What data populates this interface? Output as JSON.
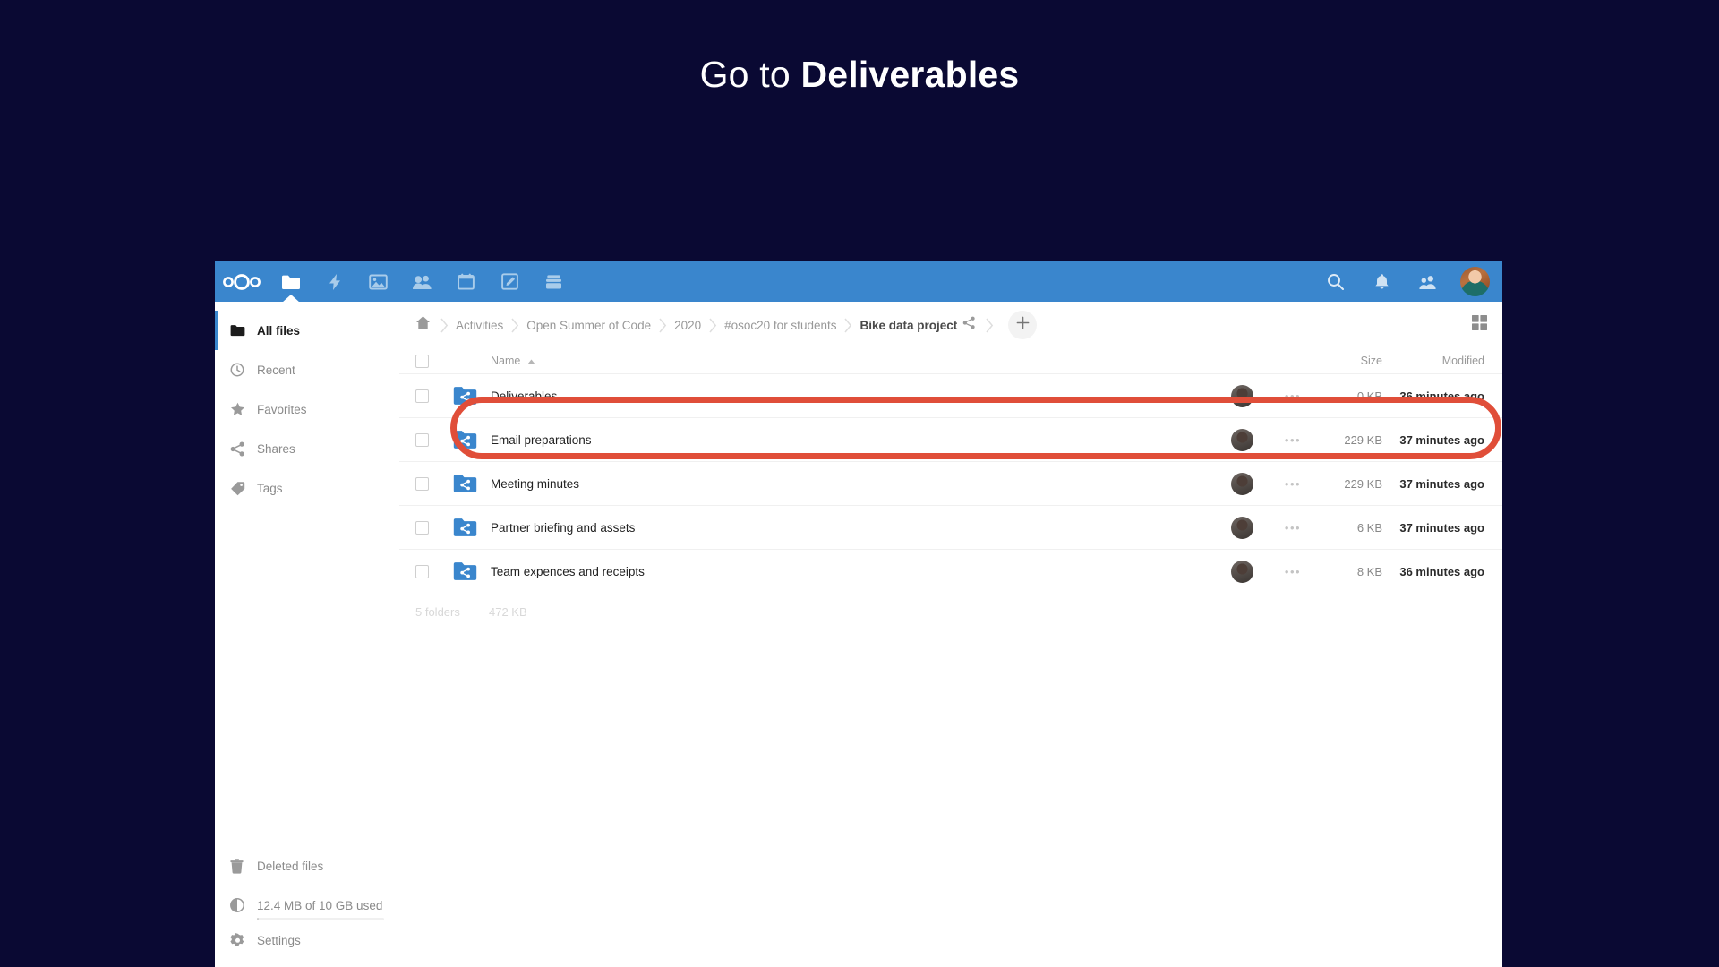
{
  "slide": {
    "title_plain": "Go to ",
    "title_bold": "Deliverables",
    "background_color": "#0a0933"
  },
  "app": {
    "accent_color": "#3a86cd",
    "annotation_color": "#e04e39",
    "header": {
      "logo_name": "nextcloud-logo",
      "nav_items": [
        {
          "icon": "folder-icon",
          "label": "Files",
          "active": true
        },
        {
          "icon": "activity-lightning-icon",
          "label": "Activity",
          "active": false
        },
        {
          "icon": "photos-icon",
          "label": "Photos",
          "active": false
        },
        {
          "icon": "contacts-icon",
          "label": "Contacts",
          "active": false
        },
        {
          "icon": "calendar-icon",
          "label": "Calendar",
          "active": false
        },
        {
          "icon": "notes-edit-icon",
          "label": "Notes",
          "active": false
        },
        {
          "icon": "deck-icon",
          "label": "Deck",
          "active": false
        }
      ],
      "right_items": [
        {
          "icon": "search-icon",
          "label": "Search"
        },
        {
          "icon": "bell-icon",
          "label": "Notifications"
        },
        {
          "icon": "contacts-menu-icon",
          "label": "Contacts menu"
        }
      ],
      "avatar_name": "user-avatar"
    },
    "sidebar": {
      "items": [
        {
          "icon": "folder-icon",
          "label": "All files",
          "active": true
        },
        {
          "icon": "clock-icon",
          "label": "Recent",
          "active": false
        },
        {
          "icon": "star-icon",
          "label": "Favorites",
          "active": false
        },
        {
          "icon": "share-icon",
          "label": "Shares",
          "active": false
        },
        {
          "icon": "tag-icon",
          "label": "Tags",
          "active": false
        }
      ],
      "bottom": {
        "deleted_files": {
          "icon": "trash-icon",
          "label": "Deleted files"
        },
        "quota": {
          "icon": "quota-pie-icon",
          "label": "12.4 MB of 10 GB used",
          "percent": 1.2
        },
        "settings": {
          "icon": "gear-icon",
          "label": "Settings"
        }
      }
    },
    "breadcrumb": {
      "home_icon": "home-icon",
      "items": [
        "Activities",
        "Open Summer of Code",
        "2020",
        "#osoc20 for students",
        "Bike data project"
      ],
      "share_icon": "share-icon",
      "new_button_label": "+"
    },
    "view_toggle": {
      "icon": "grid-view-icon",
      "label": "Grid view"
    },
    "table": {
      "headers": {
        "name": "Name",
        "size": "Size",
        "modified": "Modified"
      },
      "sort": {
        "column": "Name",
        "direction": "ascending"
      },
      "rows": [
        {
          "name": "Deliverables",
          "size": "0 KB",
          "modified": "36 minutes ago",
          "icon": "shared-folder-icon",
          "highlighted": true
        },
        {
          "name": "Email preparations",
          "size": "229 KB",
          "modified": "37 minutes ago",
          "icon": "shared-folder-icon",
          "highlighted": false
        },
        {
          "name": "Meeting minutes",
          "size": "229 KB",
          "modified": "37 minutes ago",
          "icon": "shared-folder-icon",
          "highlighted": false
        },
        {
          "name": "Partner briefing and assets",
          "size": "6 KB",
          "modified": "37 minutes ago",
          "icon": "shared-folder-icon",
          "highlighted": false
        },
        {
          "name": "Team expences and receipts",
          "size": "8 KB",
          "modified": "36 minutes ago",
          "icon": "shared-folder-icon",
          "highlighted": false
        }
      ],
      "footer": {
        "count": "5 folders",
        "total_size": "472 KB"
      }
    }
  }
}
